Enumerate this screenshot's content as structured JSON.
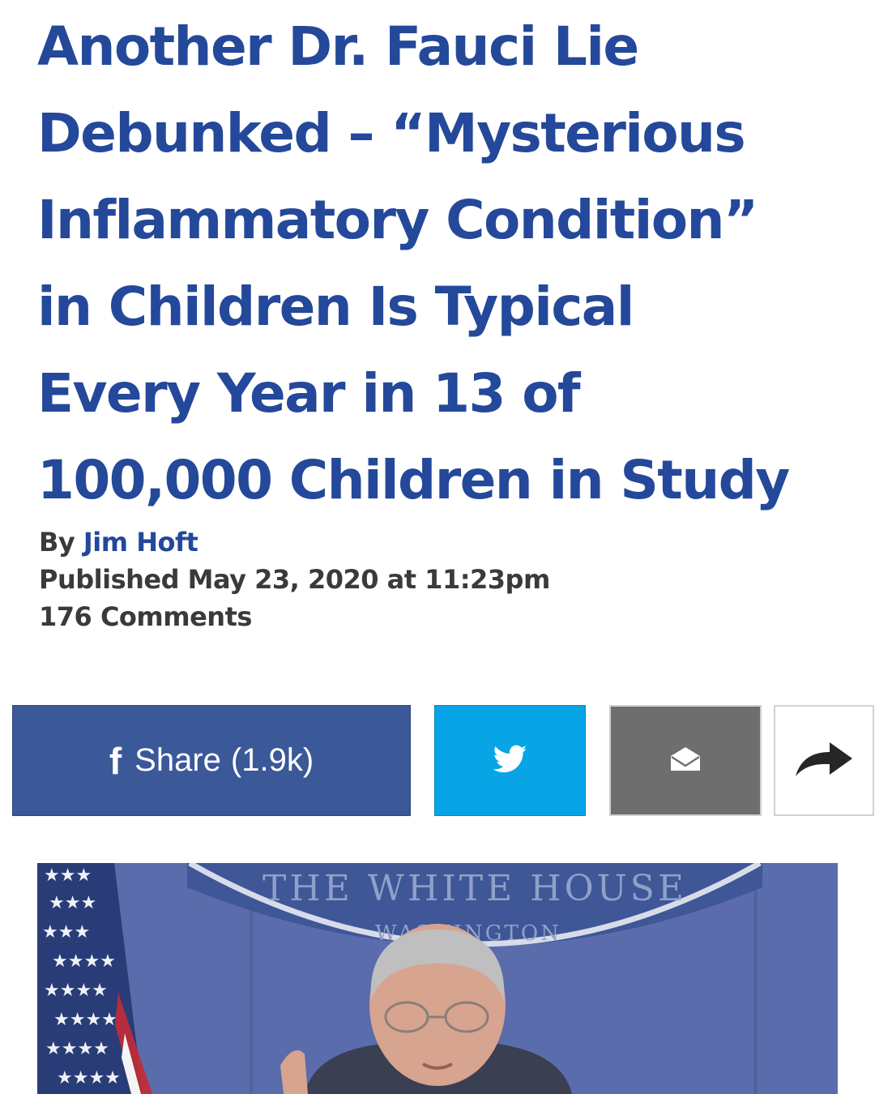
{
  "article": {
    "headline_lines": [
      "Another Dr. Fauci Lie",
      "Debunked – “Mysterious",
      "Inflammatory Condition”",
      "in Children Is Typical",
      "Every Year in 13 of",
      "100,000 Children in Study"
    ],
    "byline_prefix": "By",
    "author": "Jim Hoft",
    "published": "Published May 23, 2020 at 11:23pm",
    "comments": "176 Comments"
  },
  "share_bar": {
    "facebook_icon": "f",
    "facebook_label": "Share",
    "facebook_count": "(1.9k)",
    "twitter_icon": "twitter-bird-icon",
    "email_icon": "envelope-open-icon",
    "more_icon": "share-arrow-icon"
  },
  "photo": {
    "seal_line_1": "THE WHITE HOUSE",
    "seal_line_2": "WASHINGTON"
  },
  "colors": {
    "headline": "#24489a",
    "facebook": "#3b5898",
    "twitter": "#08a5e6",
    "email": "#6e6e6e",
    "meta_text": "#3a3a3a"
  }
}
